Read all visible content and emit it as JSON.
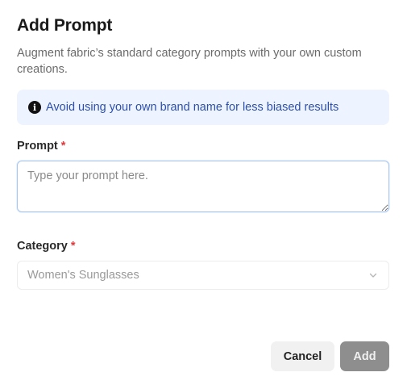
{
  "dialog": {
    "title": "Add Prompt",
    "subtitle": "Augment fabric’s standard category prompts with your own custom creations."
  },
  "info_banner": {
    "icon": "info-icon",
    "text": "Avoid using your own brand name for less biased results",
    "background_color": "#eef4ff",
    "text_color": "#2c4fae"
  },
  "prompt_field": {
    "label": "Prompt",
    "required_marker": "*",
    "value": "",
    "placeholder": "Type your prompt here."
  },
  "category_field": {
    "label": "Category",
    "required_marker": "*",
    "selected_value": "Women's Sunglasses",
    "icon": "chevron-down-icon"
  },
  "actions": {
    "cancel_label": "Cancel",
    "add_label": "Add",
    "add_disabled": true
  },
  "colors": {
    "required_marker": "#e5383b",
    "add_button_disabled": "#8e8e8e"
  }
}
